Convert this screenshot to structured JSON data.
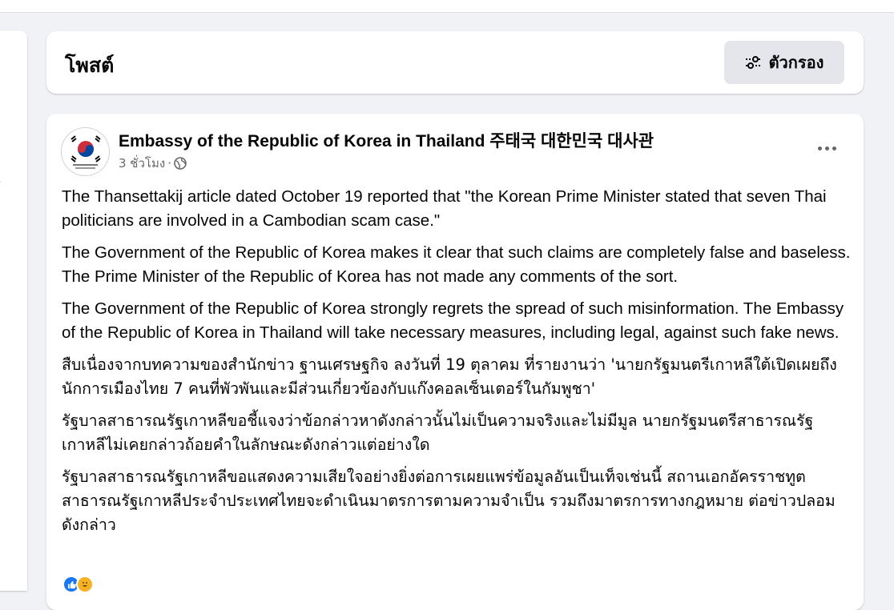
{
  "page": {
    "section_title": "โพสต์",
    "filter_button": {
      "label": "ตัวกรอง",
      "icon": "sliders-icon"
    }
  },
  "post": {
    "author": "Embassy of the Republic of Korea in Thailand 주태국 대한민국 대사관",
    "time": "3 ชั่วโมง",
    "separator": "·",
    "privacy_icon": "globe-icon",
    "paragraphs": [
      "The Thansettakij article dated October 19 reported that \"the Korean Prime Minister stated that seven Thai politicians are involved in a Cambodian scam case.\"",
      "The Government of the Republic of Korea makes it clear that such claims are completely false and baseless. The Prime Minister of the Republic of Korea has not made any comments of the sort.",
      "The Government of the Republic of Korea strongly regrets the spread of such misinformation. The Embassy of the Republic of Korea in Thailand will take necessary measures, including legal, against such fake news.",
      "สืบเนื่องจากบทความของสำนักข่าว ฐานเศรษฐกิจ ลงวันที่ 19 ตุลาคม ที่รายงานว่า 'นายกรัฐมนตรีเกาหลีใต้เปิดเผยถึง นักการเมืองไทย 7 คนที่พัวพันและมีส่วนเกี่ยวข้องกับแก๊งคอลเซ็นเตอร์ในกัมพูชา'",
      "รัฐบาลสาธารณรัฐเกาหลีขอชี้แจงว่าข้อกล่าวหาดังกล่าวนั้นไม่เป็นความจริงและไม่มีมูล นายกรัฐมนตรีสาธารณรัฐเกาหลีไม่เคยกล่าวถ้อยคำในลักษณะดังกล่าวแต่อย่างใด",
      "รัฐบาลสาธารณรัฐเกาหลีขอแสดงความเสียใจอย่างยิ่งต่อการเผยแพร่ข้อมูลอันเป็นเท็จเช่นนี้ สถานเอกอัครราชทูตสาธารณรัฐเกาหลีประจำประเทศไทยจะดำเนินมาตรการตามความจำเป็น รวมถึงมาตรการทางกฎหมาย ต่อข่าวปลอมดังกล่าว"
    ],
    "reactions": {
      "icons": [
        "like-icon",
        "haha-icon"
      ]
    }
  },
  "colors": {
    "background": "#f0f2f5",
    "card": "#ffffff",
    "secondary_text": "#65676b",
    "button_bg": "#e4e6eb",
    "like_blue": "#1877f2",
    "haha_yellow": "#f7b125"
  }
}
